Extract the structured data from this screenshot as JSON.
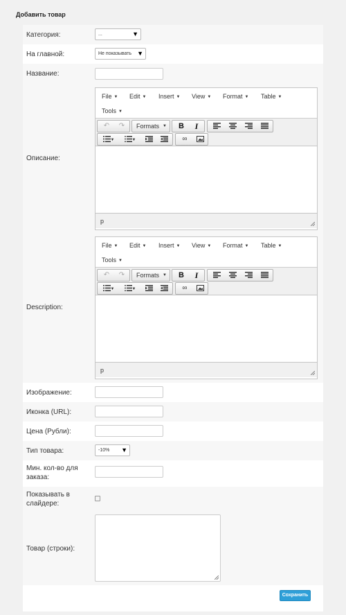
{
  "page_title": "Добавить товар",
  "fields": {
    "category": {
      "label": "Категория:",
      "value": "..."
    },
    "on_main": {
      "label": "На главной:",
      "value": "Не показывать"
    },
    "name": {
      "label": "Название:",
      "value": ""
    },
    "description_ru": {
      "label": "Описание:"
    },
    "description_en": {
      "label": "Description:"
    },
    "image": {
      "label": "Изображение:",
      "value": ""
    },
    "icon_url": {
      "label": "Иконка (URL):",
      "value": ""
    },
    "price": {
      "label": "Цена (Рубли):",
      "value": ""
    },
    "product_type": {
      "label": "Тип товара:",
      "value": "-10%"
    },
    "min_qty": {
      "label": "Мин. кол-во для заказа:",
      "value": ""
    },
    "show_in_slider": {
      "label": "Показывать в слайдере:",
      "checked": false
    },
    "product_lines": {
      "label": "Товар (строки):",
      "value": ""
    }
  },
  "editor": {
    "menus": [
      "File",
      "Edit",
      "Insert",
      "View",
      "Format",
      "Table",
      "Tools"
    ],
    "formats_label": "Formats",
    "status_path": "p",
    "toolbar_icons": [
      "undo-icon",
      "redo-icon",
      "bold-icon",
      "italic-icon",
      "align-left-icon",
      "align-center-icon",
      "align-right-icon",
      "align-justify-icon",
      "bullet-list-icon",
      "numbered-list-icon",
      "outdent-icon",
      "indent-icon",
      "link-icon",
      "image-icon"
    ]
  },
  "actions": {
    "save_label": "Сохранить"
  },
  "colors": {
    "accent": "#2e9fd8",
    "alt_row": "#f7f7f7",
    "background": "#f1f1f1"
  }
}
